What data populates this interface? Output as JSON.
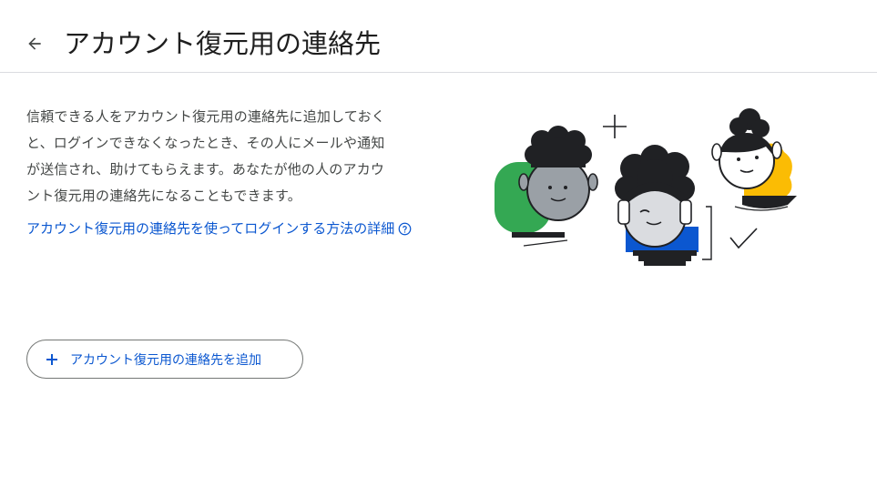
{
  "header": {
    "title": "アカウント復元用の連絡先",
    "back_icon": "arrow-left-icon"
  },
  "main": {
    "description_lines": [
      "信頼できる人をアカウント復元用の連絡先に追加しておく",
      "と、ログインできなくなったとき、その人にメールや通知",
      "が送信され、助けてもらえます。あなたが他の人のアカウ",
      "ント復元用の連絡先になることもできます。"
    ],
    "learn_more_link": "アカウント復元用の連絡先を使ってログインする方法の詳細",
    "help_icon": "help-circle-icon",
    "add_button": {
      "label": "アカウント復元用の連絡先を追加",
      "icon": "plus-icon"
    }
  },
  "colors": {
    "accent": "#0b57d0",
    "green": "#34a853",
    "blue": "#0b57d0",
    "yellow": "#fbbc04",
    "dark": "#202124"
  }
}
